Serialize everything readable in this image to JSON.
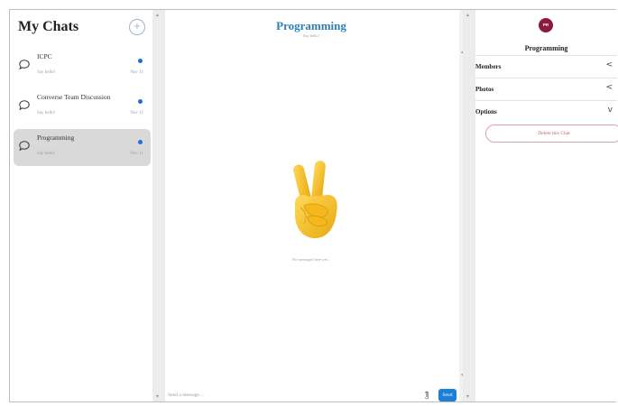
{
  "sidebar": {
    "title": "My Chats",
    "new_chat_glyph": "+",
    "chats": [
      {
        "name": "ICPC",
        "subtitle": "Say hello!",
        "date": "Nov 11",
        "active": false
      },
      {
        "name": "Converse Team Discussion",
        "subtitle": "Say hello!",
        "date": "Nov 11",
        "active": false
      },
      {
        "name": "Programming",
        "subtitle": "Say hello!",
        "date": "Nov 11",
        "active": true
      }
    ]
  },
  "chat": {
    "title": "Programming",
    "subtitle": "Say hello!",
    "empty_text": "No messages here yet...",
    "emoji_name": "victory-hand-icon",
    "input_placeholder": "Send a message...",
    "send_label": "Send",
    "attach_icon": "attach-icon"
  },
  "details": {
    "avatar_initials": "PR",
    "name": "Programming",
    "sections": [
      {
        "label": "Members",
        "chevron": "<",
        "state": "collapsed"
      },
      {
        "label": "Photos",
        "chevron": "<",
        "state": "collapsed"
      },
      {
        "label": "Options",
        "chevron": "v",
        "state": "expanded"
      }
    ],
    "delete_label": "Delete this Chat"
  },
  "colors": {
    "title_blue": "#2d7fb5",
    "send_blue": "#1e7fd6",
    "unread_dot": "#1e6fd9",
    "avatar": "#8d1b3d",
    "delete_text": "#c9606a",
    "active_chat_bg": "#d9d9d9"
  }
}
